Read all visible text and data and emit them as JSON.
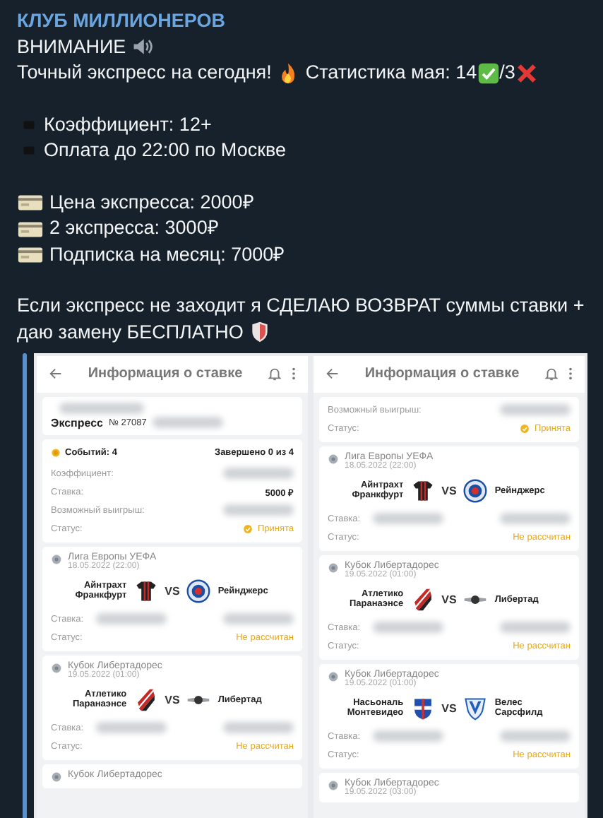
{
  "channel": {
    "name": "КЛУБ МИЛЛИОНЕРОВ"
  },
  "message": {
    "paragraphs": [
      [
        [
          {
            "kind": "text",
            "text": "ВНИМАНИЕ"
          },
          {
            "kind": "speaker"
          }
        ],
        [
          {
            "kind": "text",
            "text": "Точный экспресс на сегодня!"
          },
          {
            "kind": "fire"
          },
          {
            "kind": "text",
            "text": "Статистика мая: 14"
          },
          {
            "kind": "check"
          },
          {
            "kind": "text",
            "text": "/3"
          },
          {
            "kind": "cross"
          }
        ]
      ],
      [
        [
          {
            "kind": "bullet"
          },
          {
            "kind": "text",
            "text": "Коэффициент: 12+"
          }
        ],
        [
          {
            "kind": "bullet"
          },
          {
            "kind": "text",
            "text": "Оплата до 22:00 по Москве"
          }
        ]
      ],
      [
        [
          {
            "kind": "card"
          },
          {
            "kind": "text",
            "text": "Цена экспресса: 2000₽"
          }
        ],
        [
          {
            "kind": "card"
          },
          {
            "kind": "text",
            "text": "2 экспресса: 3000₽"
          }
        ],
        [
          {
            "kind": "card"
          },
          {
            "kind": "text",
            "text": "Подписка на месяц: 7000₽"
          }
        ]
      ],
      [
        [
          {
            "kind": "text",
            "text": "Если экспресс не заходит я СДЕЛАЮ ВОЗВРАТ суммы ставки +"
          }
        ],
        [
          {
            "kind": "text",
            "text": "даю замену БЕСПЛАТНО"
          },
          {
            "kind": "shield"
          }
        ]
      ]
    ]
  },
  "screens": [
    {
      "title": "Информация о ставке",
      "blocks": [
        {
          "kind": "express",
          "title": "Экспресс",
          "number": "№ 27087"
        },
        {
          "kind": "summary",
          "events": "Событий: 4",
          "completed": "Завершено 0 из 4",
          "rows": [
            {
              "label": "Коэффициент:",
              "redacted": true
            },
            {
              "label": "Ставка:",
              "value": "5000 ₽",
              "redacted": false
            },
            {
              "label": "Возможный выигрыш:",
              "redacted": true
            }
          ],
          "status": {
            "label": "Статус:",
            "value": "Принята",
            "kind": "accepted"
          }
        },
        {
          "kind": "match",
          "league": "Лига Европы УЕФА",
          "date": "18.05.2022 (22:00)",
          "home": {
            "name": "Айнтрахт Франкфурт",
            "kind": "shirt"
          },
          "vs": "VS",
          "away": {
            "name": "Рейнджерс",
            "kind": "round"
          },
          "stake": "Ставка:",
          "status": {
            "label": "Статус:",
            "value": "Не рассчитан",
            "kind": "pending"
          }
        },
        {
          "kind": "match",
          "league": "Кубок Либертадорес",
          "date": "19.05.2022 (01:00)",
          "home": {
            "name": "Атлетико Паранаэнсе",
            "kind": "stripes"
          },
          "vs": "VS",
          "away": {
            "name": "Либертад",
            "kind": "wings"
          },
          "stake": "Ставка:",
          "status": {
            "label": "Статус:",
            "value": "Не рассчитан",
            "kind": "pending"
          }
        },
        {
          "kind": "match",
          "league": "Кубок Либертадорес"
        }
      ]
    },
    {
      "title": "Информация о ставке",
      "blocks": [
        {
          "kind": "summary",
          "rows": [
            {
              "label": "Возможный выигрыш:",
              "redacted": true
            }
          ],
          "status": {
            "label": "Статус:",
            "value": "Принята",
            "kind": "accepted"
          }
        },
        {
          "kind": "match",
          "league": "Лига Европы УЕФА",
          "date": "18.05.2022 (22:00)",
          "home": {
            "name": "Айнтрахт Франкфурт",
            "kind": "shirt"
          },
          "vs": "VS",
          "away": {
            "name": "Рейнджерс",
            "kind": "round"
          },
          "stake": "Ставка:",
          "status": {
            "label": "Статус:",
            "value": "Не рассчитан",
            "kind": "pending"
          }
        },
        {
          "kind": "match",
          "league": "Кубок Либертадорес",
          "date": "19.05.2022 (01:00)",
          "home": {
            "name": "Атлетико Паранаэнсе",
            "kind": "stripes"
          },
          "vs": "VS",
          "away": {
            "name": "Либертад",
            "kind": "wings"
          },
          "stake": "Ставка:",
          "status": {
            "label": "Статус:",
            "value": "Не рассчитан",
            "kind": "pending"
          }
        },
        {
          "kind": "match",
          "league": "Кубок Либертадорес",
          "date": "19.05.2022 (01:00)",
          "home": {
            "name": "Насьональ Монтевидео",
            "kind": "shield"
          },
          "vs": "VS",
          "away": {
            "name": "Велес Сарсфилд",
            "kind": "chevron"
          },
          "stake": "Ставка:",
          "status": {
            "label": "Статус:",
            "value": "Не рассчитан",
            "kind": "pending"
          }
        },
        {
          "kind": "match",
          "league": "Кубок Либертадорес",
          "date": "19.05.2022 (03:00)"
        }
      ]
    }
  ]
}
